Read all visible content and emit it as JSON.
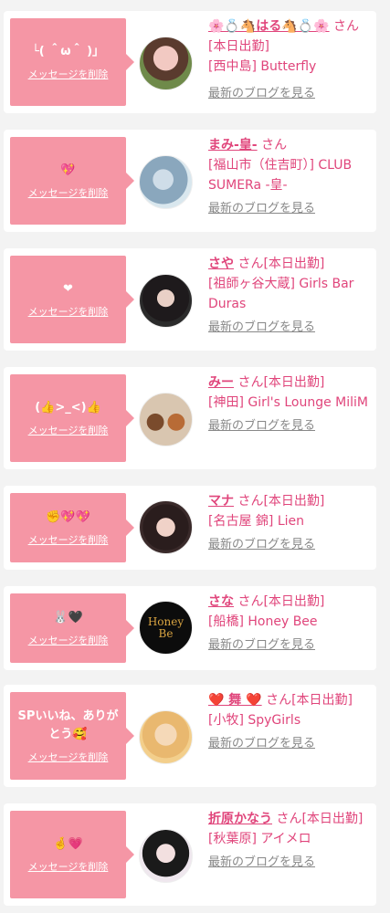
{
  "delete_label": "メッセージを削除",
  "blog_label": "最新のブログを見る",
  "colors": {
    "bubble": "#f596a5",
    "name": "#e0457b",
    "blog": "#888888"
  },
  "items": [
    {
      "message": "└( ＾ω＾ )」",
      "name": "🌸💍🐴はる🐴💍🌸",
      "suffix": "さん[本日出勤]",
      "shop": "[西中島] Butterfly"
    },
    {
      "message": "💖",
      "name": "まみ-皇-",
      "suffix": "さん",
      "shop": "[福山市（住吉町）] CLUB SUMERa -皇-"
    },
    {
      "message": "❤",
      "name": "さや",
      "suffix": "さん[本日出勤]",
      "shop": "[祖師ヶ谷大蔵] Girls Bar Duras"
    },
    {
      "message": "(👍>_<)👍",
      "name": "みー",
      "suffix": "さん[本日出勤]",
      "shop": "[神田] Girl's Lounge MiliM"
    },
    {
      "message": "✊💖💖",
      "name": "マナ",
      "suffix": "さん[本日出勤]",
      "shop": "[名古屋 錦] Lien"
    },
    {
      "message": "🐰🖤",
      "name": "さな",
      "suffix": "さん[本日出勤]",
      "shop": "[船橋] Honey Bee",
      "avatar_text": "Honey Be"
    },
    {
      "message": "SPいいね、ありがとう🥰",
      "name": "❤️ 舞 ❤️",
      "suffix": "さん[本日出勤]",
      "shop": "[小牧] SpyGirls"
    },
    {
      "message": "🤞💗",
      "name": "折原かなう",
      "suffix": "さん[本日出勤]",
      "shop": "[秋葉原] アイメロ"
    }
  ]
}
